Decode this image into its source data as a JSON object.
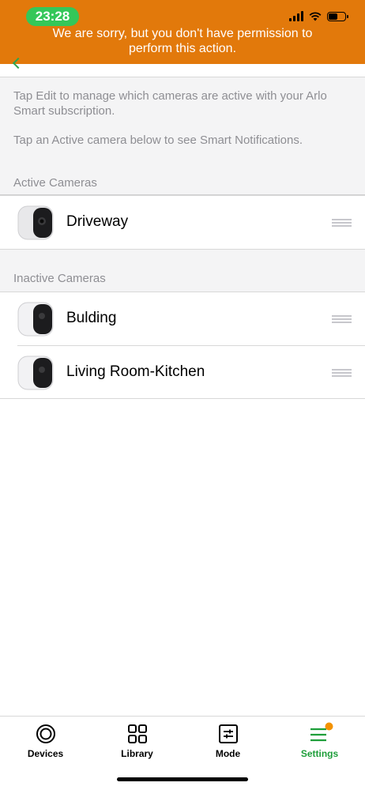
{
  "status_bar": {
    "time": "23:28"
  },
  "banner": {
    "message": "We are sorry, but you don't have permission to perform this action."
  },
  "info": {
    "line1": "Tap Edit to manage which cameras are active with your Arlo Smart subscription.",
    "line2": "Tap an Active camera below to see Smart Notifications."
  },
  "active_section": {
    "title": "Active Cameras",
    "cameras": [
      {
        "name": "Driveway"
      }
    ]
  },
  "inactive_section": {
    "title": "Inactive Cameras",
    "cameras": [
      {
        "name": "Bulding"
      },
      {
        "name": "Living Room-Kitchen"
      }
    ]
  },
  "tabbar": {
    "tabs": [
      {
        "label": "Devices",
        "icon": "devices-icon"
      },
      {
        "label": "Library",
        "icon": "library-grid-icon"
      },
      {
        "label": "Mode",
        "icon": "mode-sliders-icon"
      },
      {
        "label": "Settings",
        "icon": "settings-menu-icon",
        "active": true
      }
    ],
    "accent": "#1e9e3a",
    "badge_color": "#f39200"
  },
  "colors": {
    "banner": "#e2790b",
    "time_pill": "#34c759"
  }
}
